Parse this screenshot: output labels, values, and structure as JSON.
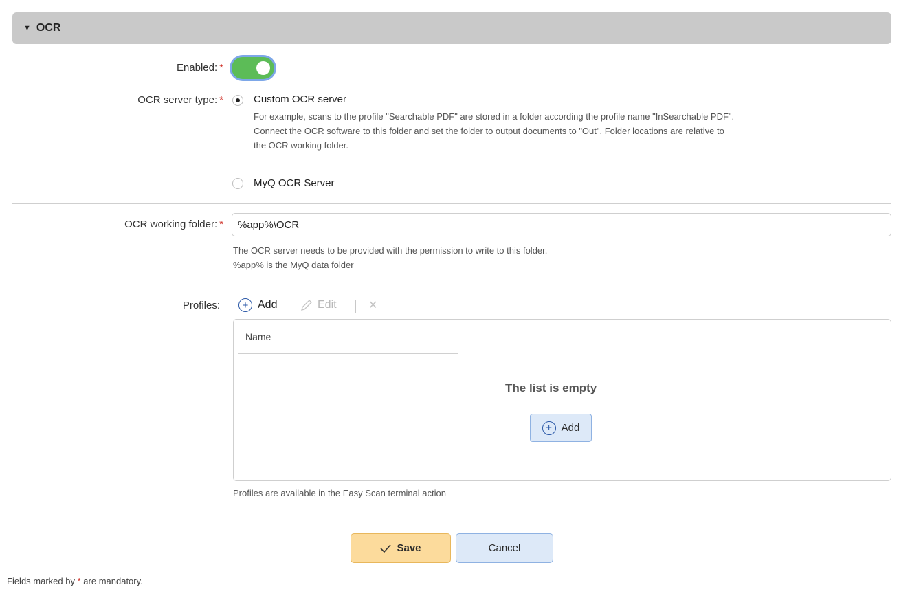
{
  "section": {
    "title": "OCR"
  },
  "enabled": {
    "label": "Enabled:",
    "required_mark": "*",
    "value": true
  },
  "server_type": {
    "label": "OCR server type:",
    "required_mark": "*",
    "options": [
      {
        "label": "Custom OCR server",
        "selected": true,
        "help_lines": [
          "For example, scans to the profile \"Searchable PDF\" are stored in a folder according the profile name \"InSearchable PDF\".",
          "Connect the OCR software to this folder and set the folder to output documents to \"Out\". Folder locations are relative to",
          "the OCR working folder."
        ]
      },
      {
        "label": "MyQ OCR Server",
        "selected": false
      }
    ]
  },
  "working_folder": {
    "label": "OCR working folder:",
    "required_mark": "*",
    "value": "%app%\\OCR",
    "help_lines": [
      "The OCR server needs to be provided with the permission to write to this folder.",
      "%app% is the MyQ data folder"
    ]
  },
  "profiles": {
    "label": "Profiles:",
    "toolbar": {
      "add": "Add",
      "edit": "Edit",
      "delete_symbol": "✕"
    },
    "column_header": "Name",
    "empty_text": "The list is empty",
    "empty_add": "Add",
    "help": "Profiles are available in the Easy Scan terminal action"
  },
  "actions": {
    "save": "Save",
    "cancel": "Cancel"
  },
  "footer": {
    "prefix": "Fields marked by",
    "mark": "*",
    "suffix": "are mandatory."
  },
  "colors": {
    "toggle_on": "#5cbc57",
    "required": "#d0342c",
    "primary_btn": "#fcdb9c",
    "secondary_btn": "#dde9f8",
    "header_bg": "#c9c9c9"
  }
}
